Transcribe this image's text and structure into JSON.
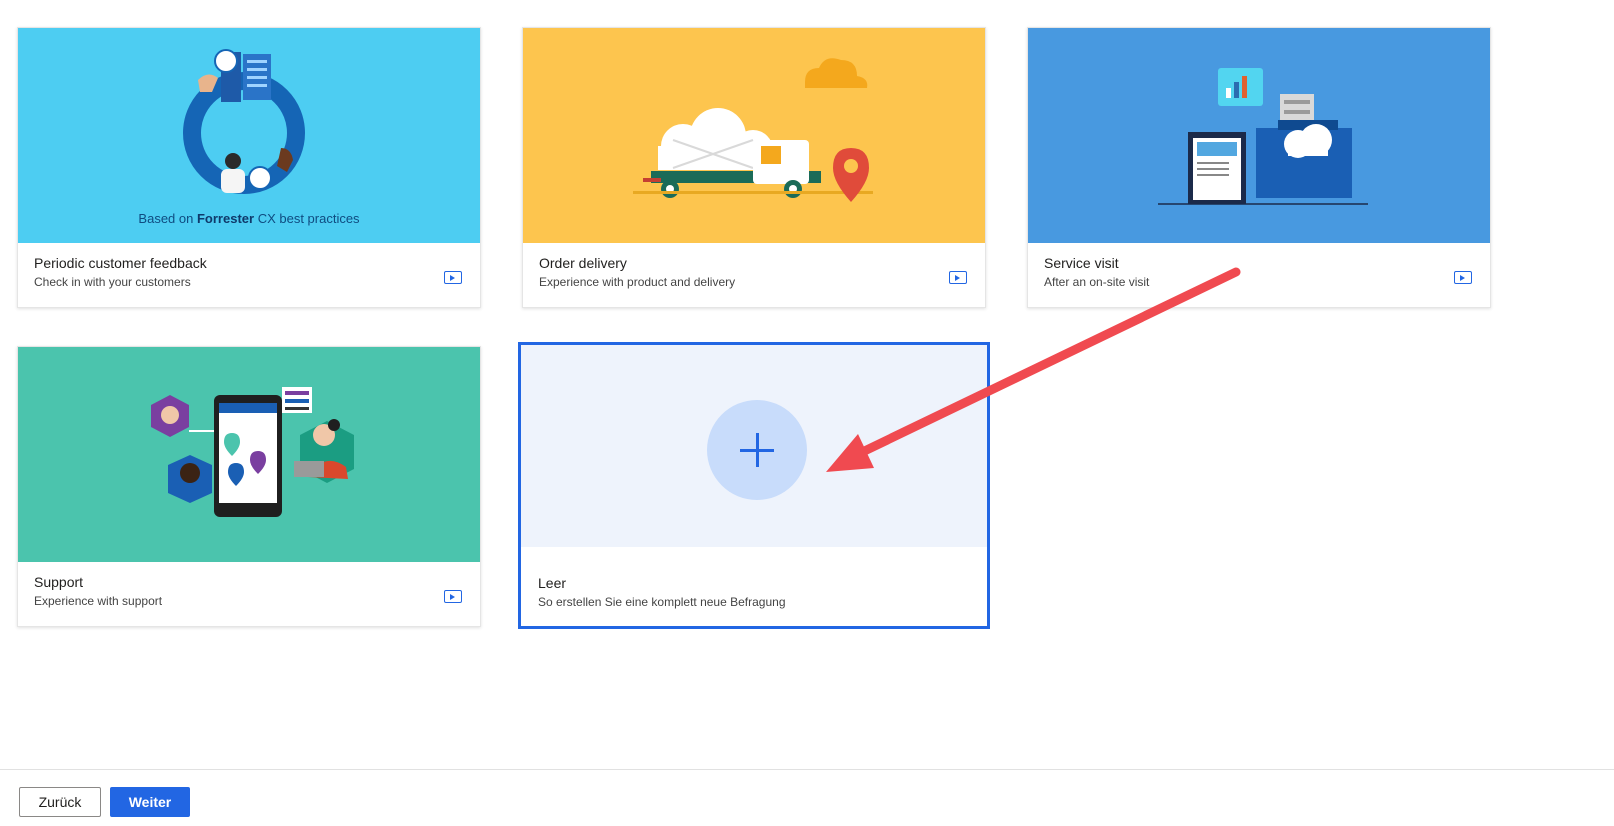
{
  "templates": [
    {
      "title": "Periodic customer feedback",
      "subtitle": "Check in with your customers",
      "banner_color": "#4dcdf2",
      "badge_prefix": "Based on",
      "badge_bold": "Forrester",
      "badge_suffix": "CX best practices"
    },
    {
      "title": "Order delivery",
      "subtitle": "Experience with product and delivery",
      "banner_color": "#fdc54e"
    },
    {
      "title": "Service visit",
      "subtitle": "After an on-site visit",
      "banner_color": "#4899e0"
    },
    {
      "title": "Support",
      "subtitle": "Experience with support",
      "banner_color": "#4bc4ad"
    },
    {
      "title": "Leer",
      "subtitle": "So erstellen Sie eine komplett neue Befragung",
      "selected": true
    }
  ],
  "icons": {
    "preview": "play-video-icon",
    "blank": "plus-icon",
    "annotation": "red-arrow"
  },
  "footer": {
    "back_label": "Zurück",
    "next_label": "Weiter"
  },
  "colors": {
    "accent": "#2266e3",
    "annotation": "#f04a50"
  }
}
